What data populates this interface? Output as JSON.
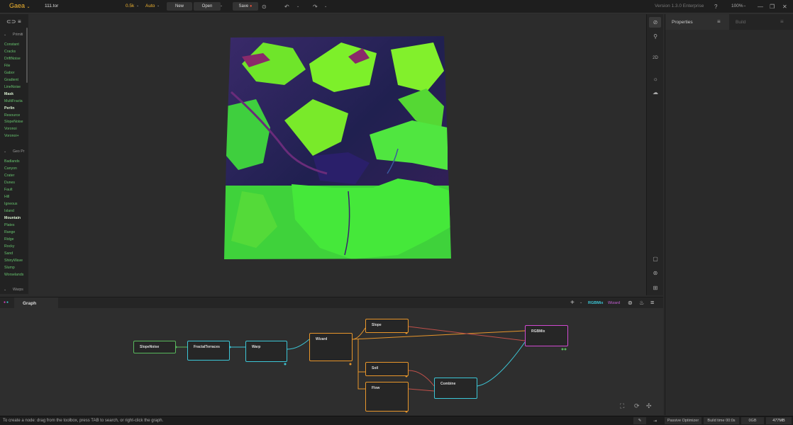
{
  "app": {
    "brand": "Gaea",
    "brand_caret": "⌄",
    "filename": "111.tor",
    "version": "Version 1.3.0 Enterprise",
    "zoom": "100%"
  },
  "toolbar": {
    "resolution": "0.5k",
    "build_mode": "Auto",
    "new_label": "New",
    "open_label": "Open",
    "save_label": "Save"
  },
  "toolbox": {
    "sections": [
      {
        "label": "Primiti",
        "items": [
          "Constant",
          "Cracks",
          "DriftNoise",
          "File",
          "Gabor",
          "Gradient",
          "LineNoise",
          "Mask",
          "MultiFracta",
          "Perlin",
          "Resource",
          "SlopeNoise",
          "Voronoi",
          "Voronoi+"
        ]
      },
      {
        "label": "Geo Pr",
        "items": [
          "Badlands",
          "Canyon",
          "Crater",
          "Dunes",
          "Fault",
          "Hill",
          "Igneous",
          "Island",
          "Mountain",
          "Plates",
          "Range",
          "Ridge",
          "Rocky",
          "Sand",
          "ShinyWave",
          "Slump",
          "Worselands"
        ]
      },
      {
        "label": "Warps",
        "items": []
      }
    ],
    "highlighted": [
      "Mask",
      "Perlin",
      "Mountain"
    ]
  },
  "viewport": {
    "mode_2d": "2D"
  },
  "properties": {
    "tab_properties": "Properties",
    "tab_build": "Build"
  },
  "graph": {
    "tab_label": "Graph",
    "node_rgbmix": "RGBMix",
    "wizard_label": "Wizard",
    "nodes": [
      "SlopeNoise",
      "FractalTerraces",
      "Warp",
      "Wizard",
      "Slope",
      "Soil",
      "Flow",
      "Combine",
      "RGBMix"
    ]
  },
  "status": {
    "hint": "To create a node: drag from the toolbox, press TAB to search, or right-click the graph.",
    "optimizer": "Passive Optimizer",
    "build_time": "Build time 00:0s",
    "gpu_mem": "0GB",
    "mem": "477MB"
  },
  "colors": {
    "brand": "#f2b531",
    "accent_green": "#67c36e",
    "node_orange": "#e8962b",
    "node_cyan": "#3cc6d6",
    "node_magenta": "#d04ad0",
    "node_green": "#58b85c"
  }
}
